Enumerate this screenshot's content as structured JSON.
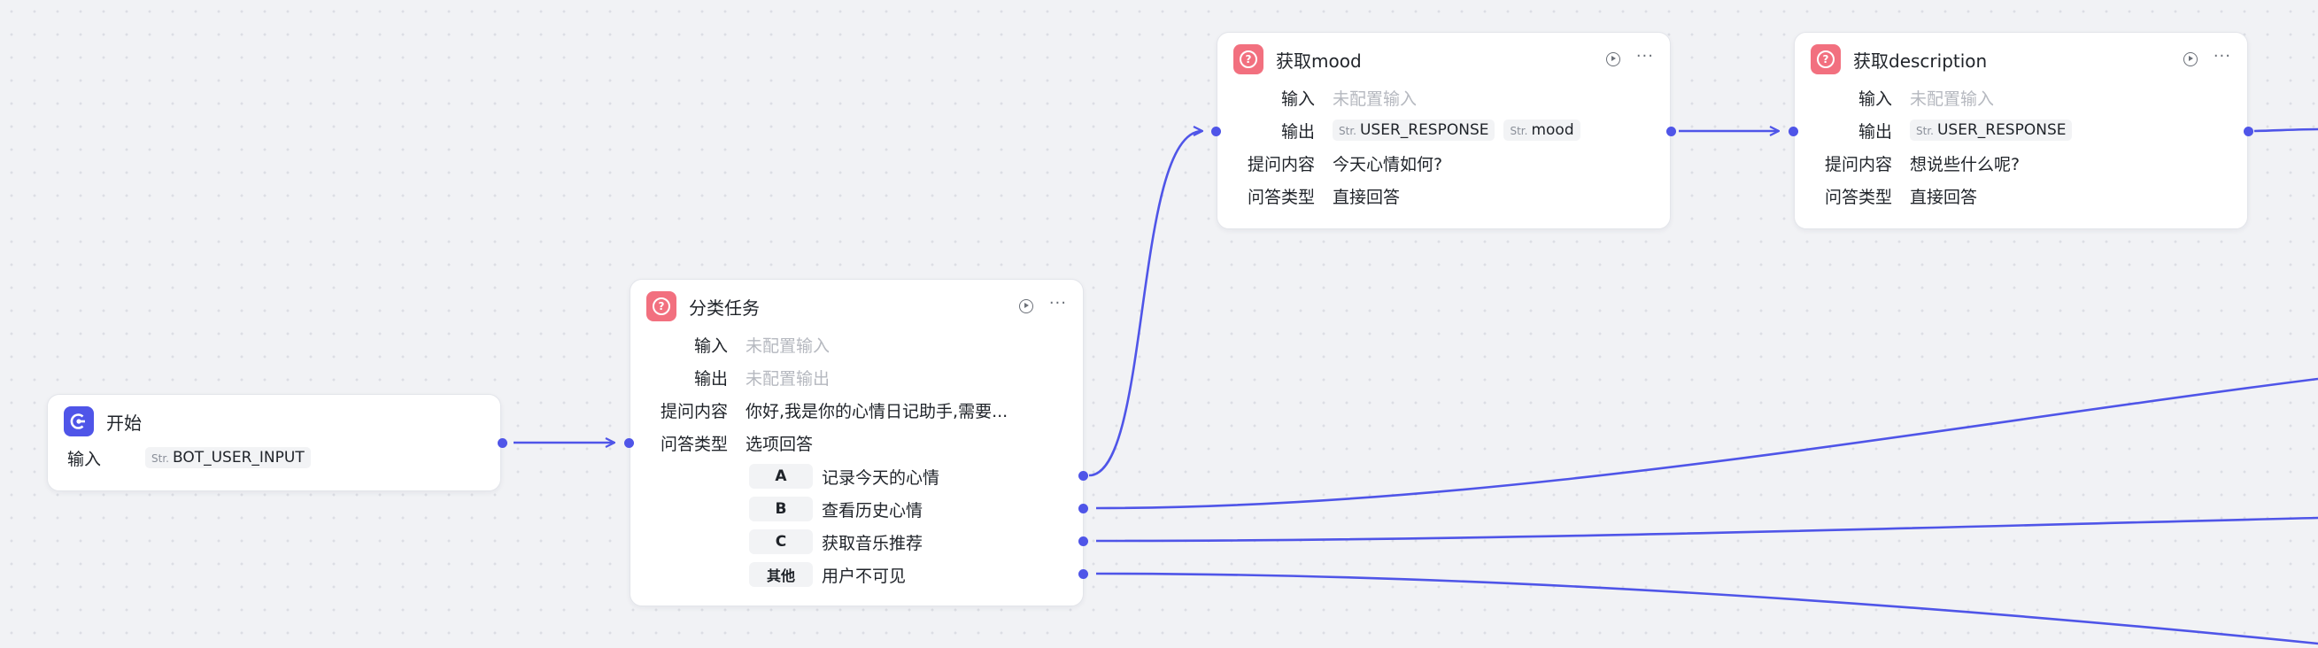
{
  "colors": {
    "edge": "#4f55e8",
    "question_badge": "#f2707f",
    "start_badge": "#4f55e8",
    "canvas": "#f1f2f5"
  },
  "start": {
    "title": "开始",
    "input_label": "输入",
    "input_type": "Str.",
    "input_value": "BOT_USER_INPUT",
    "icon": "start-icon"
  },
  "classify": {
    "title": "分类任务",
    "input_label": "输入",
    "input_value": "未配置输入",
    "output_label": "输出",
    "output_value": "未配置输出",
    "question_label": "提问内容",
    "question_value": "你好,我是你的心情日记助手,需要...",
    "type_label": "问答类型",
    "type_value": "选项回答",
    "options": [
      {
        "key": "A",
        "text": "记录今天的心情"
      },
      {
        "key": "B",
        "text": "查看历史心情"
      },
      {
        "key": "C",
        "text": "获取音乐推荐"
      },
      {
        "key": "其他",
        "text": "用户不可见"
      }
    ]
  },
  "mood": {
    "title": "获取mood",
    "input_label": "输入",
    "input_value": "未配置输入",
    "output_label": "输出",
    "outputs": [
      {
        "type": "Str.",
        "name": "USER_RESPONSE"
      },
      {
        "type": "Str.",
        "name": "mood"
      }
    ],
    "question_label": "提问内容",
    "question_value": "今天心情如何?",
    "type_label": "问答类型",
    "type_value": "直接回答"
  },
  "description": {
    "title": "获取description",
    "input_label": "输入",
    "input_value": "未配置输入",
    "output_label": "输出",
    "outputs": [
      {
        "type": "Str.",
        "name": "USER_RESPONSE"
      }
    ],
    "question_label": "提问内容",
    "question_value": "想说些什么呢?",
    "type_label": "问答类型",
    "type_value": "直接回答"
  }
}
